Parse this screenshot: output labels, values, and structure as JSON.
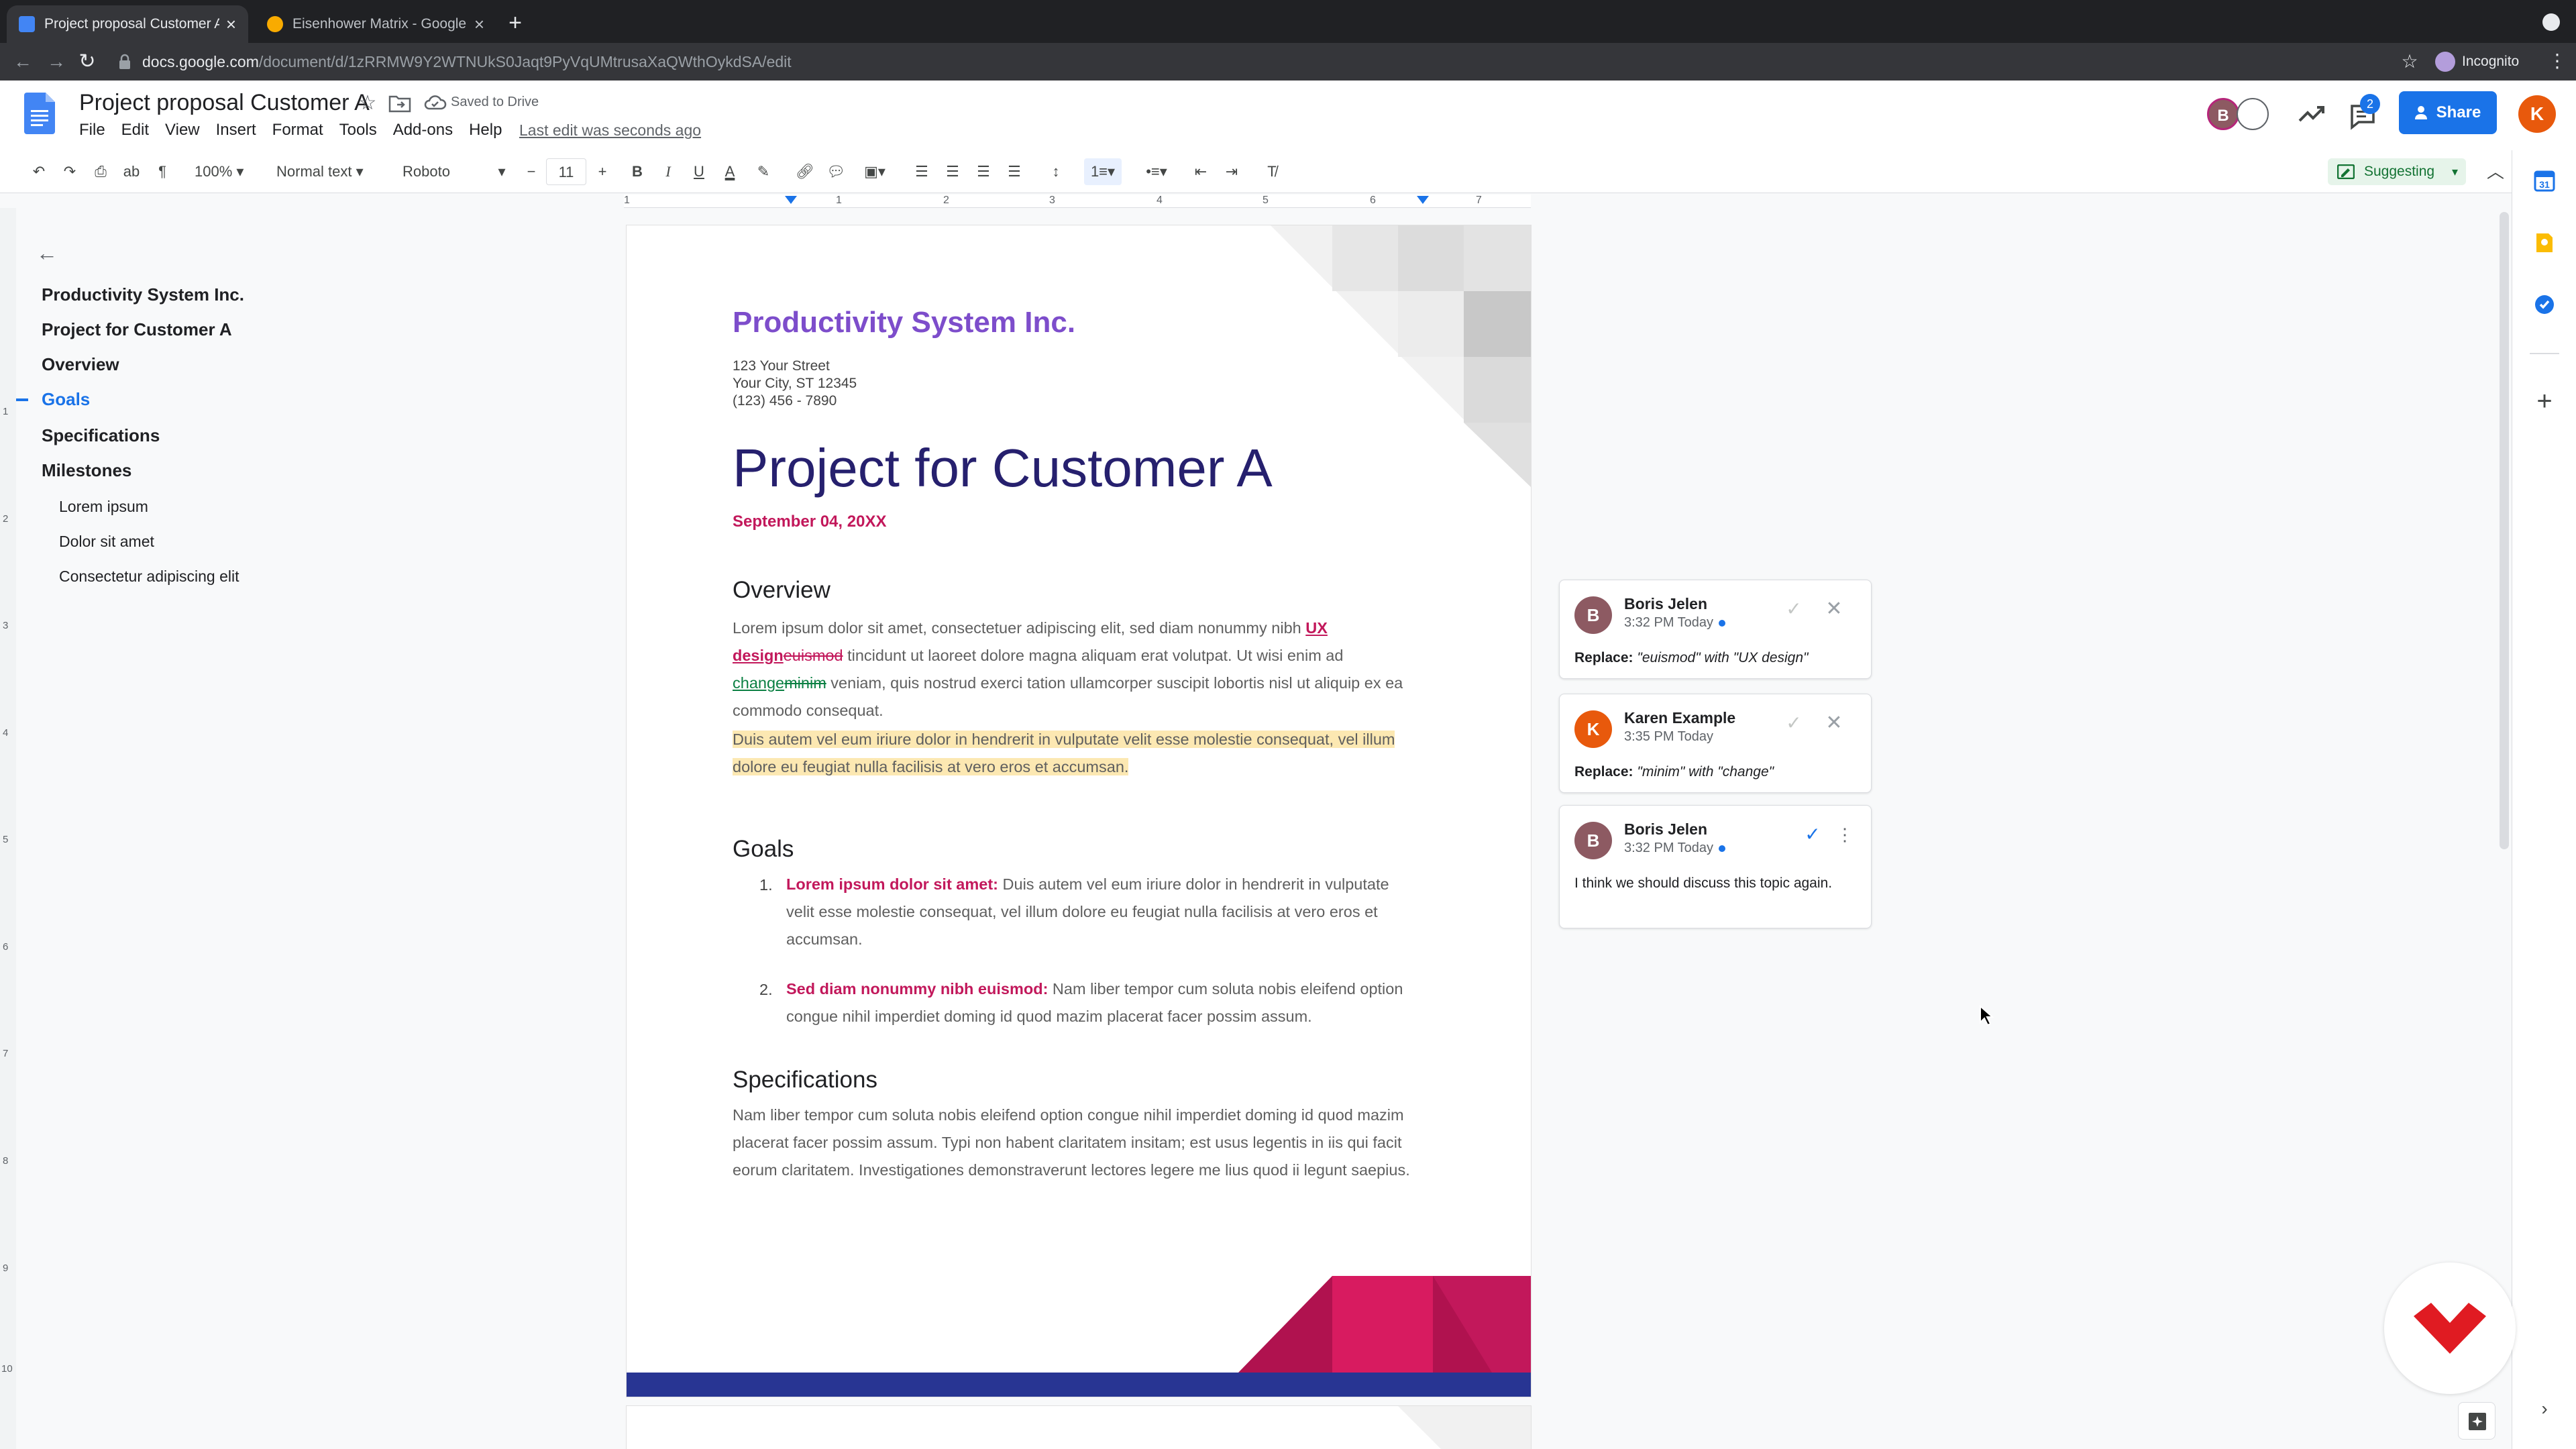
{
  "browser": {
    "tabs": [
      {
        "title": "Project proposal Customer A - ",
        "active": true
      },
      {
        "title": "Eisenhower Matrix - Google Ja",
        "active": false
      }
    ],
    "new_tab": "+",
    "url_host": "docs.google.com",
    "url_path": "/document/d/1zRRMW9Y2WTNUkS0Jaqt9PyVqUMtrusaXaQWthOykdSA/edit",
    "incognito_label": "Incognito"
  },
  "doc": {
    "title": "Project proposal Customer A",
    "saved_status": "Saved to Drive",
    "menu": [
      "File",
      "Edit",
      "View",
      "Insert",
      "Format",
      "Tools",
      "Add-ons",
      "Help"
    ],
    "last_edit": "Last edit was seconds ago",
    "share_label": "Share",
    "comments_count": "2",
    "avatars": {
      "b": "B",
      "k": "K"
    }
  },
  "toolbar": {
    "zoom": "100%",
    "style": "Normal text",
    "font": "Roboto",
    "font_size": "11",
    "mode": "Suggesting"
  },
  "ruler": [
    "1",
    "1",
    "2",
    "3",
    "4",
    "5",
    "6",
    "7"
  ],
  "vruler": [
    "1",
    "2",
    "3",
    "4",
    "5",
    "6",
    "7",
    "8",
    "9",
    "10"
  ],
  "outline": {
    "items": [
      {
        "label": "Productivity System Inc.",
        "level": 1
      },
      {
        "label": "Project for Customer A",
        "level": 1
      },
      {
        "label": "Overview",
        "level": 1
      },
      {
        "label": "Goals",
        "level": 1,
        "active": true
      },
      {
        "label": "Specifications",
        "level": 1
      },
      {
        "label": "Milestones",
        "level": 1
      },
      {
        "label": "Lorem ipsum",
        "level": 2
      },
      {
        "label": "Dolor sit amet",
        "level": 2
      },
      {
        "label": "Consectetur adipiscing elit",
        "level": 2
      }
    ]
  },
  "page": {
    "company": "Productivity System Inc.",
    "address": [
      "123 Your Street",
      "Your City, ST 12345",
      "(123) 456 - 7890"
    ],
    "title": "Project for Customer A",
    "date": "September 04, 20XX",
    "overview_heading": "Overview",
    "overview": {
      "p1": "Lorem ipsum dolor sit amet, consectetuer adipiscing elit, sed diam nonummy nibh ",
      "ins1": "UX design",
      "del1": "euismod",
      "p2": " tincidunt ut laoreet dolore magna aliquam erat volutpat. Ut wisi enim ad ",
      "ins2": "change",
      "del2": "minim",
      "p3": " veniam, quis nostrud exerci tation ullamcorper suscipit lobortis nisl ut aliquip ex ea commodo consequat.",
      "highlight": "Duis autem vel eum iriure dolor in hendrerit in vulputate velit esse molestie consequat, vel illum dolore eu feugiat nulla facilisis at vero eros et accumsan."
    },
    "goals_heading": "Goals",
    "goals": [
      {
        "num": "1.",
        "bold": "Lorem ipsum dolor sit amet:",
        "text": " Duis autem vel eum iriure dolor in hendrerit in vulputate velit esse molestie consequat, vel illum dolore eu feugiat nulla facilisis at vero eros et accumsan."
      },
      {
        "num": "2.",
        "bold": "Sed diam nonummy nibh euismod:",
        "text": " Nam liber tempor cum soluta nobis eleifend option congue nihil imperdiet doming id quod mazim placerat facer possim assum."
      }
    ],
    "spec_heading": "Specifications",
    "spec": "Nam liber tempor cum soluta nobis eleifend option congue nihil imperdiet doming id quod mazim placerat facer possim assum. Typi non habent claritatem insitam; est usus legentis in iis qui facit eorum claritatem. Investigationes demonstraverunt lectores legere me lius quod ii legunt saepius."
  },
  "comments": [
    {
      "initial": "B",
      "name": "Boris Jelen",
      "time": "3:32 PM Today",
      "label": "Replace:",
      "text": " \"euismod\" with \"UX design\"",
      "color": "#8d5a62"
    },
    {
      "initial": "K",
      "name": "Karen Example",
      "time": "3:35 PM Today",
      "label": "Replace:",
      "text": " \"minim\" with \"change\"",
      "color": "#e8590c"
    },
    {
      "initial": "B",
      "name": "Boris Jelen",
      "time": "3:32 PM Today",
      "label": "",
      "text": "I think we should discuss this topic again.",
      "color": "#8d5a62"
    }
  ],
  "colors": {
    "accent": "#1a73e8",
    "pink": "#c2185b",
    "purple": "#7d4dcb",
    "navy": "#26206e",
    "suggest_green": "#137333"
  }
}
